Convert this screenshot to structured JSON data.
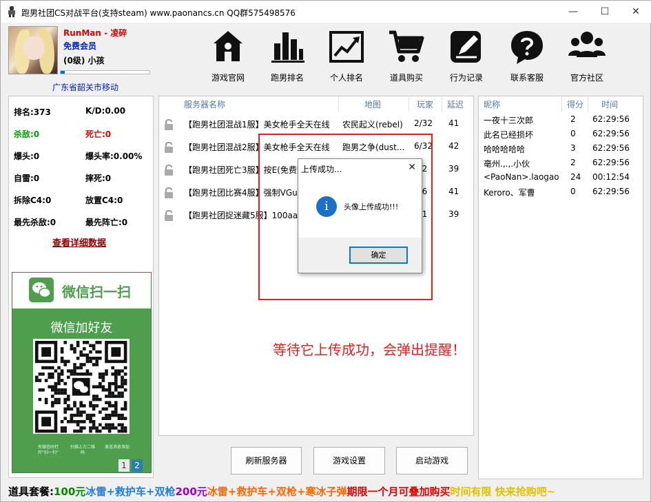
{
  "window": {
    "title": "跑男社团CS对战平台(支持steam) www.paonancs.cn QQ群575498576",
    "minimize": "—",
    "maximize": "☐",
    "close": "✕"
  },
  "user": {
    "name": "RunMan - 凌碎",
    "membership": "免费会员",
    "level": "(0级) 小孩",
    "xp_fraction": 0.05,
    "location": "广东省韶关市移动"
  },
  "nav": [
    {
      "label": "游戏官网",
      "icon": "house-icon"
    },
    {
      "label": "跑男排名",
      "icon": "bar-chart-icon"
    },
    {
      "label": "个人排名",
      "icon": "line-chart-icon"
    },
    {
      "label": "道具购买",
      "icon": "shopping-cart-icon"
    },
    {
      "label": "行为记录",
      "icon": "edit-icon"
    },
    {
      "label": "联系客服",
      "icon": "help-bubble-icon"
    },
    {
      "label": "官方社区",
      "icon": "community-icon"
    }
  ],
  "stats": {
    "rank": "排名:373",
    "kd": "K/D:0.00",
    "kills": "杀敌:0",
    "deaths": "死亡:0",
    "headshots": "爆头:0",
    "headshot_rate": "爆头率:0.00%",
    "grenade": "自雷:0",
    "fall": "摔死:0",
    "defuse": "拆除C4:0",
    "plant": "放置C4:0",
    "first_kill": "最先杀敌:0",
    "first_death": "最先阵亡:0",
    "detail_link": "查看详细数据"
  },
  "qr": {
    "header": "微信扫一扫",
    "subtitle": "微信加好友",
    "steps": [
      "有微信时打开“扫一扫”",
      "扫描上方二维码",
      "发送消息添加"
    ],
    "pages": [
      "1",
      "2"
    ]
  },
  "servers": {
    "headers": [
      "服务器名称",
      "地图",
      "玩家",
      "延迟"
    ],
    "rows": [
      {
        "name": "【跑男社团混战1服】美女枪手全天在线",
        "map": "农民起义(rebel)",
        "players": "2/32",
        "ping": "41"
      },
      {
        "name": "【跑男社团混战2服】美女枪手全天在线",
        "map": "跑男之争(dust...",
        "players": "6/32",
        "ping": "42"
      },
      {
        "name": "【跑男社团死亡3服】按E(免费购买装备)",
        "map": "",
        "players": "/32",
        "ping": "39"
      },
      {
        "name": "【跑男社团比赛4服】强制VGua...",
        "map": "",
        "players": "/16",
        "ping": "41"
      },
      {
        "name": "【跑男社团捉迷藏5服】100aa...",
        "map": "",
        "players": "/21",
        "ping": "39"
      }
    ]
  },
  "players": {
    "headers": [
      "昵称",
      "得分",
      "时间"
    ],
    "rows": [
      {
        "nick": "一夜十三次郎",
        "score": "2",
        "time": "62:29:56"
      },
      {
        "nick": "此名已经损坏",
        "score": "0",
        "time": "62:29:56"
      },
      {
        "nick": "哈哈哈哈哈",
        "score": "3",
        "time": "62:29:56"
      },
      {
        "nick": "亳州.,.,.小伙",
        "score": "2",
        "time": "62:29:56"
      },
      {
        "nick": "<PaoNan>.laogao",
        "score": "24",
        "time": "00:12:54"
      },
      {
        "nick": "Keroro、军曹",
        "score": "0",
        "time": "62:29:56"
      }
    ]
  },
  "buttons": {
    "refresh": "刷新服务器",
    "settings": "游戏设置",
    "launch": "启动游戏"
  },
  "promo": [
    {
      "text": "道具套餐:",
      "color": "#000000"
    },
    {
      "text": "100元",
      "color": "#008800"
    },
    {
      "text": "冰雷+救护车+双枪",
      "color": "#1a7fe0"
    },
    {
      "text": "200元",
      "color": "#9900cc"
    },
    {
      "text": "冰雷+救护车+双枪+寒冰子弹",
      "color": "#ff6600"
    },
    {
      "text": "期限一个月可叠加购买",
      "color": "#e00000"
    },
    {
      "text": "时间有限 快来抢购吧~",
      "color": "#e0c000"
    }
  ],
  "annotation": {
    "hint": "等待它上传成功，会弹出提醒！"
  },
  "dialog": {
    "title": "上传成功...",
    "message": "头像上传成功!!!",
    "ok": "确定",
    "close": "✕",
    "info_glyph": "i"
  },
  "colors": {
    "accent_blue": "#0078d7",
    "highlight_red": "#e02020",
    "wechat_green": "#4f9e4e"
  }
}
